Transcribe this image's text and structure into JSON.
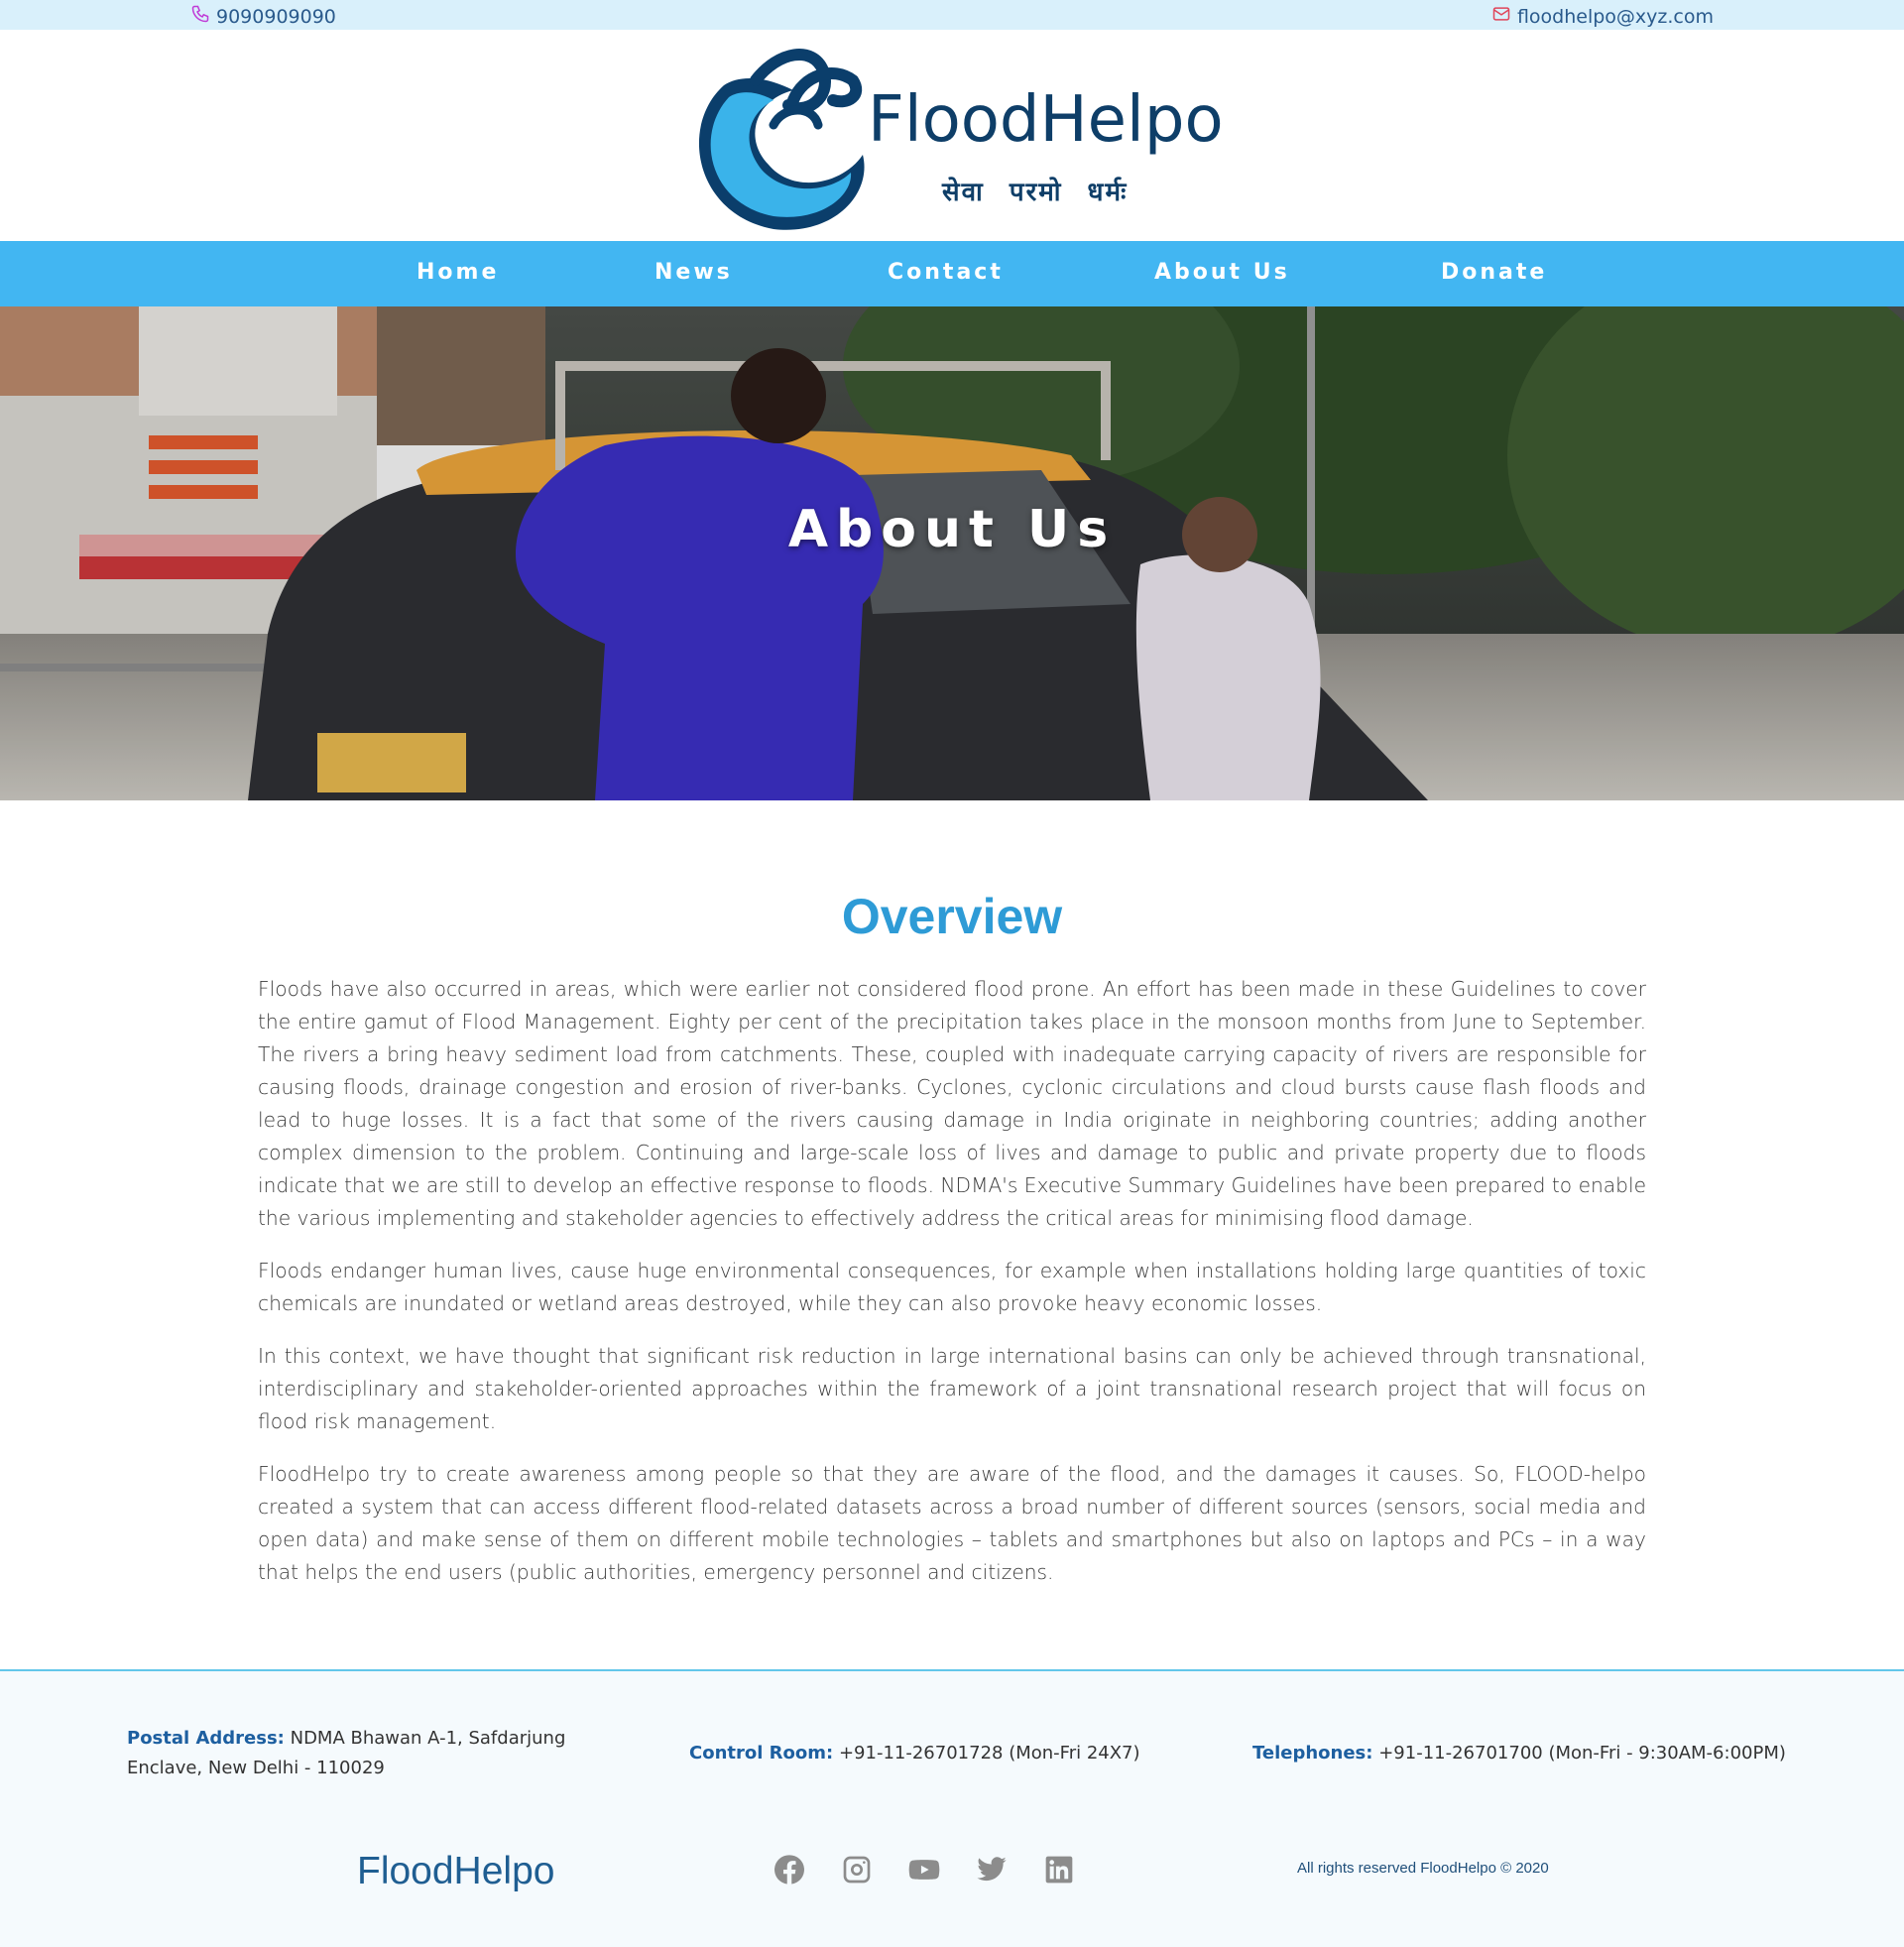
{
  "topbar": {
    "phone": "9090909090",
    "email": "floodhelpo@xyz.com"
  },
  "brand": {
    "name": "FloodHelpo",
    "tagline": "सेवा परमो धर्मः"
  },
  "nav": {
    "items": [
      "Home",
      "News",
      "Contact",
      "About Us",
      "Donate"
    ]
  },
  "hero": {
    "title": "About Us"
  },
  "overview": {
    "title": "Overview",
    "paragraphs": [
      "Floods have also occurred in areas, which were earlier not considered flood prone. An effort has been made in these Guidelines to cover the entire gamut of Flood Management. Eighty per cent of the precipitation takes place in the monsoon months from June to September. The rivers a bring heavy sediment load from catchments. These, coupled with inadequate carrying capacity of rivers are responsible for causing floods, drainage congestion and erosion of river-banks. Cyclones, cyclonic circulations and cloud bursts cause flash floods and lead to huge losses. It is a fact that some of the rivers causing damage in India originate in neighboring countries; adding another complex dimension to the problem. Continuing and large-scale loss of lives and damage to public and private property due to floods indicate that we are still to develop an effective response to floods. NDMA's Executive Summary Guidelines have been prepared to enable the various implementing and stakeholder agencies to effectively address the critical areas for minimising flood damage.",
      "Floods endanger human lives, cause huge environmental consequences, for example when installations holding large quantities of toxic chemicals are inundated or wetland areas destroyed, while they can also provoke heavy economic losses.",
      "In this context, we have thought that significant risk reduction in large international basins can only be achieved through transnational, interdisciplinary and stakeholder-oriented approaches within the framework of a joint transnational research project that will focus on flood risk management.",
      "FloodHelpo try to create awareness among people so that they are aware of the flood, and the damages it causes. So, FLOOD-helpo created a system that can access different flood-related datasets across a broad number of different sources (sensors, social media and open data) and make sense of them on different mobile technologies – tablets and smartphones but also on laptops and PCs – in a way that helps the end users (public authorities, emergency personnel and citizens."
    ]
  },
  "footer": {
    "postal_label": "Postal Address:",
    "postal_value": "NDMA Bhawan A-1, Safdarjung Enclave, New Delhi - 110029",
    "control_label": "Control Room:",
    "control_value": "+91-11-26701728 (Mon-Fri 24X7)",
    "tel_label": "Telephones:",
    "tel_value": "+91-11-26701700 (Mon-Fri - 9:30AM-6:00PM)",
    "brand": "FloodHelpo",
    "social_icons": [
      "facebook-icon",
      "instagram-icon",
      "youtube-icon",
      "twitter-icon",
      "linkedin-icon"
    ],
    "copyright": "All rights reserved FloodHelpo © 2020"
  },
  "colors": {
    "topbar_bg": "#d9f0fb",
    "nav_bg": "#42b6f2",
    "overview_title": "#2e9bd6",
    "brand_dark": "#0e3e68",
    "footer_border": "#62c6ea"
  }
}
